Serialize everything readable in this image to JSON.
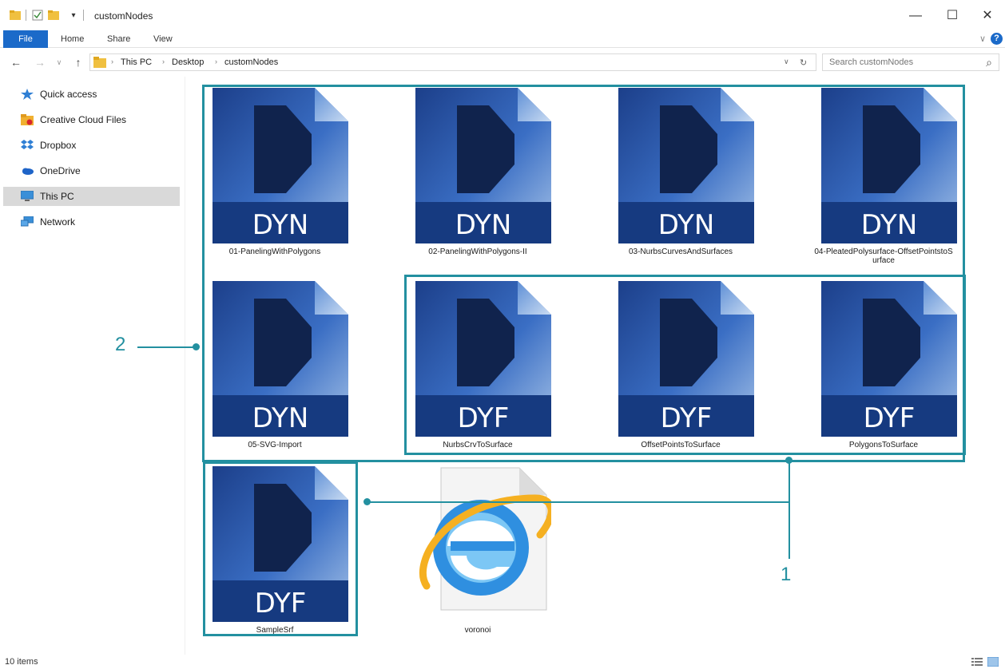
{
  "window": {
    "title": "customNodes",
    "minimize_glyph": "—",
    "maximize_glyph": "☐",
    "close_glyph": "✕",
    "accent_color": "#1b6ac9"
  },
  "ribbon": {
    "tabs": [
      "File",
      "Home",
      "Share",
      "View"
    ],
    "expand_glyph": "∨",
    "help_glyph": "?"
  },
  "address": {
    "back_glyph": "←",
    "forward_glyph": "→",
    "recent_glyph": "∨",
    "up_glyph": "↑",
    "crumbs": [
      "This PC",
      "Desktop",
      "customNodes"
    ],
    "crumb_separator": "›",
    "dropdown_glyph": "∨",
    "refresh_glyph": "↻",
    "search_placeholder": "Search customNodes",
    "search_icon_glyph": "⌕"
  },
  "sidebar": {
    "items": [
      {
        "label": "Quick access",
        "icon": "star-icon"
      },
      {
        "label": "Creative Cloud Files",
        "icon": "creative-cloud-icon"
      },
      {
        "label": "Dropbox",
        "icon": "dropbox-icon"
      },
      {
        "label": "OneDrive",
        "icon": "onedrive-icon"
      },
      {
        "label": "This PC",
        "icon": "computer-icon",
        "selected": true
      },
      {
        "label": "Network",
        "icon": "network-icon"
      }
    ]
  },
  "files": [
    {
      "name": "01-PanelingWithPolygons",
      "type": "DYN"
    },
    {
      "name": "02-PanelingWithPolygons-II",
      "type": "DYN"
    },
    {
      "name": "03-NurbsCurvesAndSurfaces",
      "type": "DYN"
    },
    {
      "name": "04-PleatedPolysurface-OffsetPointstoS urface",
      "type": "DYN"
    },
    {
      "name": "05-SVG-Import",
      "type": "DYN"
    },
    {
      "name": "NurbsCrvToSurface",
      "type": "DYF"
    },
    {
      "name": "OffsetPointsToSurface",
      "type": "DYF"
    },
    {
      "name": "PolygonsToSurface",
      "type": "DYF"
    },
    {
      "name": "SampleSrf",
      "type": "DYF"
    },
    {
      "name": "voronoi",
      "type": "HTML"
    }
  ],
  "annotations": {
    "callout_1": "1",
    "callout_2": "2",
    "color": "#2390a0"
  },
  "status": {
    "item_count": "10 items"
  }
}
